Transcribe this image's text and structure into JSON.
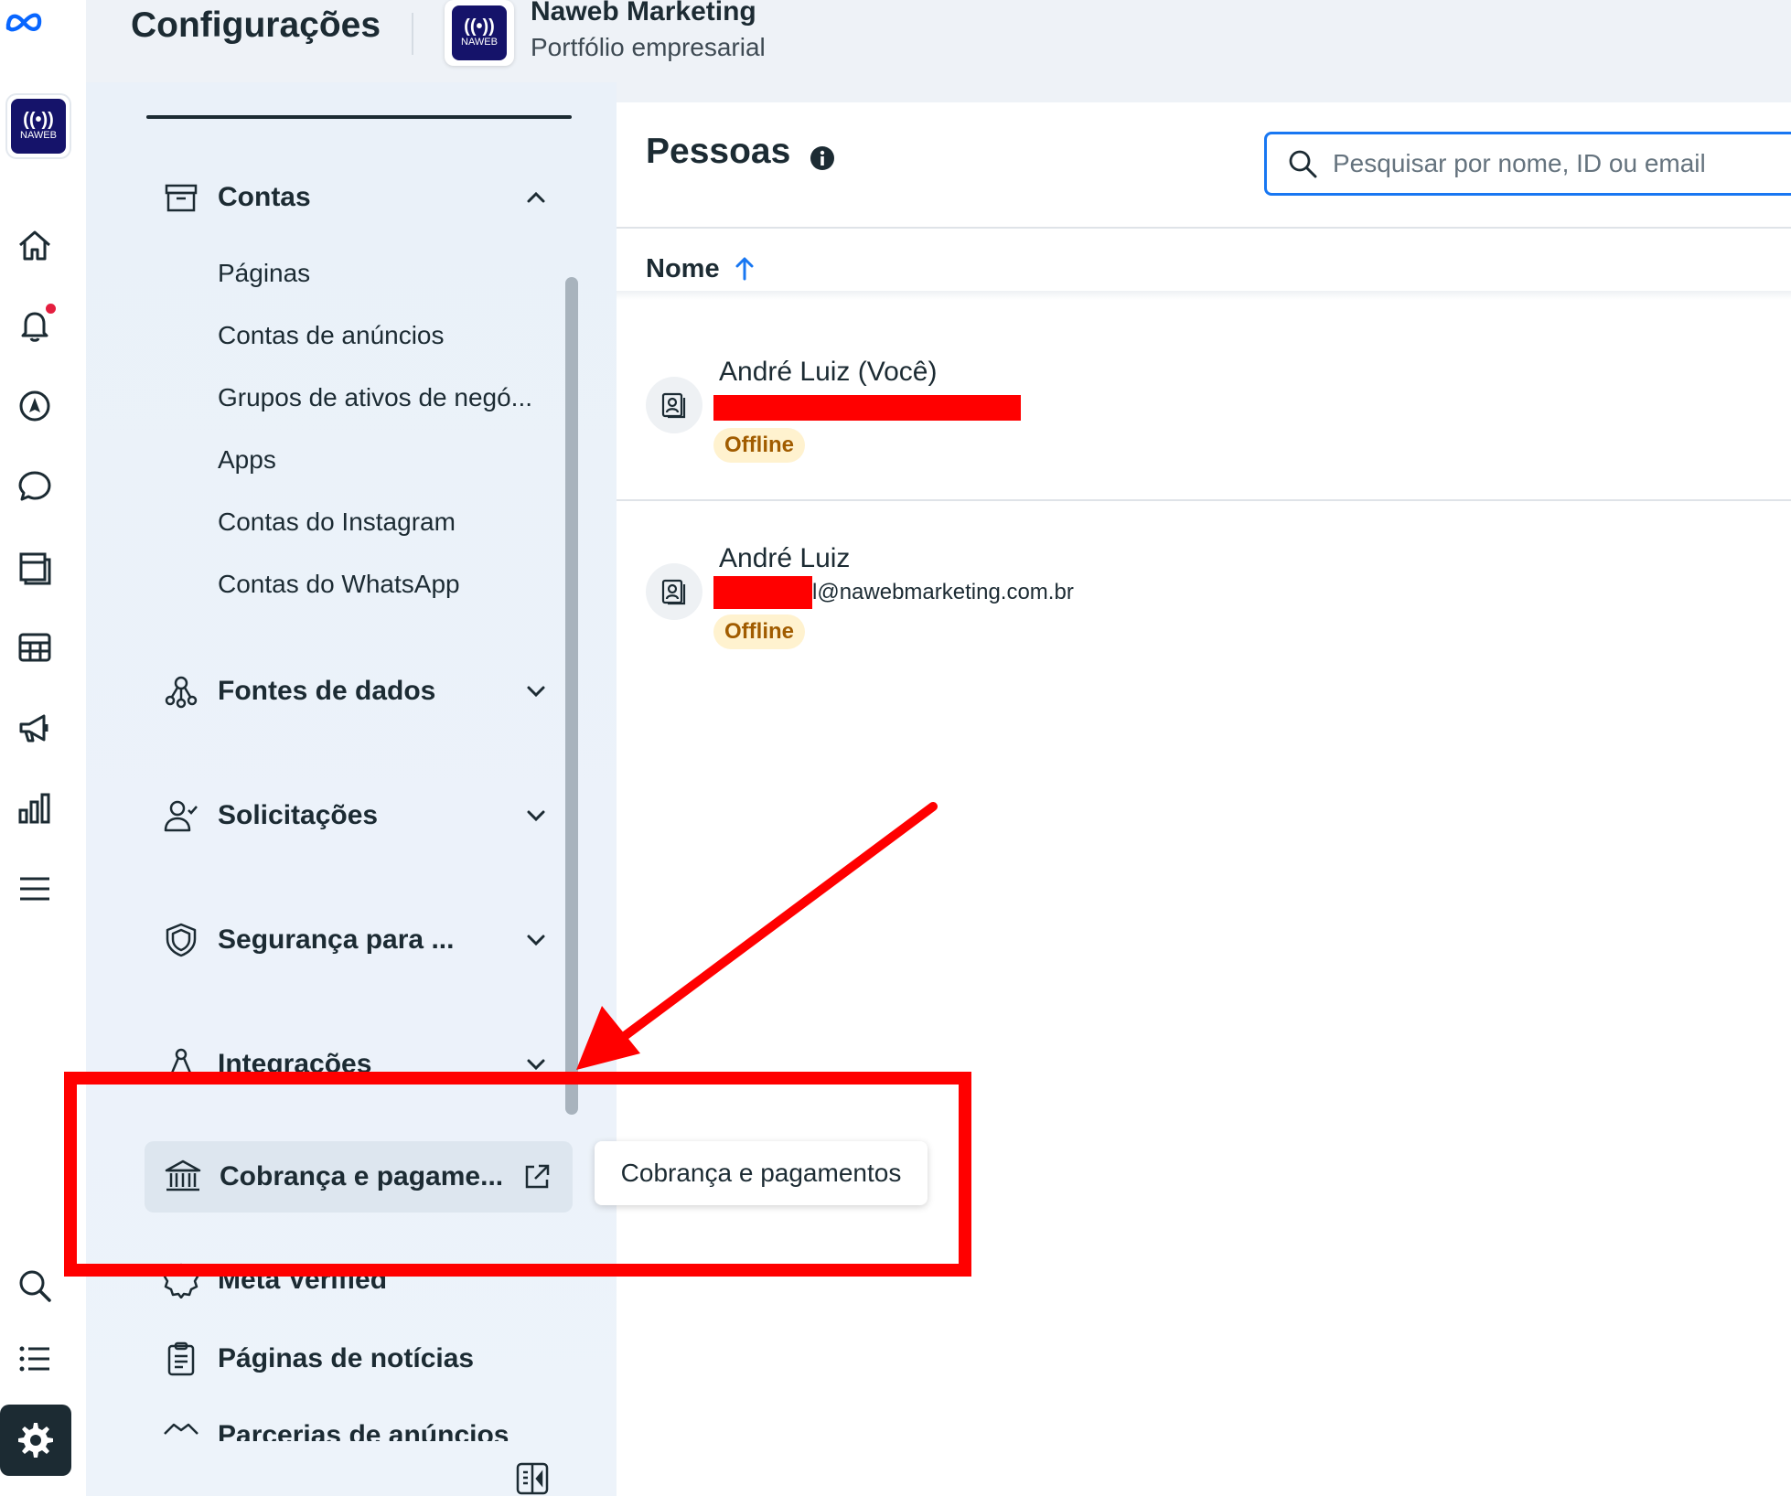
{
  "header": {
    "app_title": "Configurações",
    "business_name": "Naweb Marketing",
    "business_subtitle": "Portfólio empresarial",
    "logo_text": "NAWEB"
  },
  "rail": {
    "icons": [
      "meta-logo-icon",
      "home-icon",
      "bell-icon",
      "compass-icon",
      "chat-icon",
      "pages-icon",
      "table-icon",
      "megaphone-icon",
      "bar-chart-icon",
      "menu-icon",
      "search-icon",
      "list-icon",
      "gear-icon"
    ],
    "notification_color": "#e41e3f"
  },
  "sidebar": {
    "sections": {
      "contas": {
        "label": "Contas"
      },
      "fontes": {
        "label": "Fontes de dados"
      },
      "solicitacoes": {
        "label": "Solicitações"
      },
      "seguranca": {
        "label": "Segurança para ..."
      },
      "integracoes": {
        "label": "Integrações"
      },
      "billing": {
        "label": "Cobrança e pagame..."
      },
      "meta_verified": {
        "label": "Meta Verified"
      },
      "noticias": {
        "label": "Páginas de notícias"
      },
      "parcerias": {
        "label": "Parcerias de anúncios"
      }
    },
    "contas_items": [
      "Páginas",
      "Contas de anúncios",
      "Grupos de ativos de negó...",
      "Apps",
      "Contas do Instagram",
      "Contas do WhatsApp"
    ]
  },
  "tooltip": {
    "text": "Cobrança e pagamentos"
  },
  "main": {
    "title": "Pessoas",
    "search_placeholder": "Pesquisar por nome, ID ou email",
    "column_name": "Nome",
    "people": [
      {
        "name": "André Luiz (Você)",
        "status": "Offline"
      },
      {
        "name": "André Luiz",
        "email_suffix": "l@nawebmarketing.com.br",
        "status": "Offline"
      }
    ]
  },
  "colors": {
    "accent": "#1877f2",
    "annotation": "#ff0000",
    "offline_bg": "#fff2cf",
    "offline_text": "#a15c00",
    "logo_bg": "#15136a"
  }
}
